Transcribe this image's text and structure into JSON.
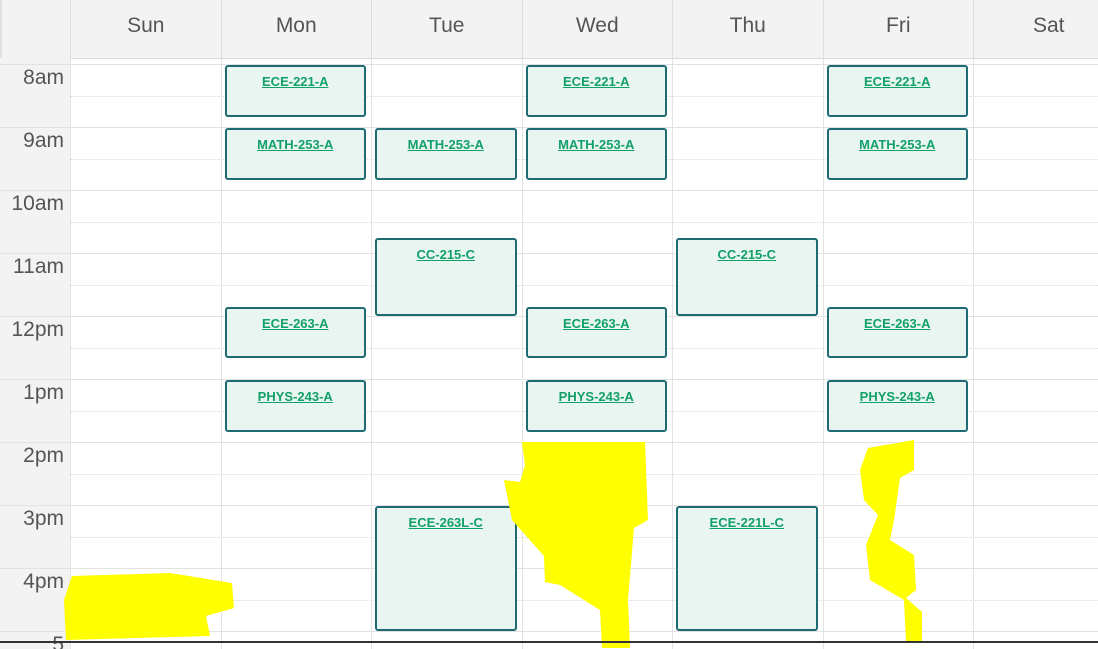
{
  "days": [
    "Sun",
    "Mon",
    "Tue",
    "Wed",
    "Thu",
    "Fri",
    "Sat"
  ],
  "hours": [
    "8am",
    "9am",
    "10am",
    "11am",
    "12pm",
    "1pm",
    "2pm",
    "3pm",
    "4pm",
    "5"
  ],
  "events": [
    {
      "title": "ECE-221-A",
      "day": "Mon",
      "start": "8:00",
      "end": "8:50"
    },
    {
      "title": "ECE-221-A",
      "day": "Wed",
      "start": "8:00",
      "end": "8:50"
    },
    {
      "title": "ECE-221-A",
      "day": "Fri",
      "start": "8:00",
      "end": "8:50"
    },
    {
      "title": "MATH-253-A",
      "day": "Mon",
      "start": "9:00",
      "end": "9:50"
    },
    {
      "title": "MATH-253-A",
      "day": "Tue",
      "start": "9:00",
      "end": "9:50"
    },
    {
      "title": "MATH-253-A",
      "day": "Wed",
      "start": "9:00",
      "end": "9:50"
    },
    {
      "title": "MATH-253-A",
      "day": "Fri",
      "start": "9:00",
      "end": "9:50"
    },
    {
      "title": "CC-215-C",
      "day": "Tue",
      "start": "10:45",
      "end": "12:00"
    },
    {
      "title": "CC-215-C",
      "day": "Thu",
      "start": "10:45",
      "end": "12:00"
    },
    {
      "title": "ECE-263-A",
      "day": "Mon",
      "start": "11:50",
      "end": "12:40"
    },
    {
      "title": "ECE-263-A",
      "day": "Wed",
      "start": "11:50",
      "end": "12:40"
    },
    {
      "title": "ECE-263-A",
      "day": "Fri",
      "start": "11:50",
      "end": "12:40"
    },
    {
      "title": "PHYS-243-A",
      "day": "Mon",
      "start": "13:00",
      "end": "13:50"
    },
    {
      "title": "PHYS-243-A",
      "day": "Wed",
      "start": "13:00",
      "end": "13:50"
    },
    {
      "title": "PHYS-243-A",
      "day": "Fri",
      "start": "13:00",
      "end": "13:50"
    },
    {
      "title": "ECE-263L-C",
      "day": "Tue",
      "start": "15:00",
      "end": "17:00"
    },
    {
      "title": "ECE-221L-C",
      "day": "Thu",
      "start": "15:00",
      "end": "17:00"
    }
  ],
  "colors": {
    "event_fill": "#e9f5f0",
    "event_border": "#1f6b73",
    "event_text": "#12a06a",
    "highlight": "#ffff00"
  }
}
